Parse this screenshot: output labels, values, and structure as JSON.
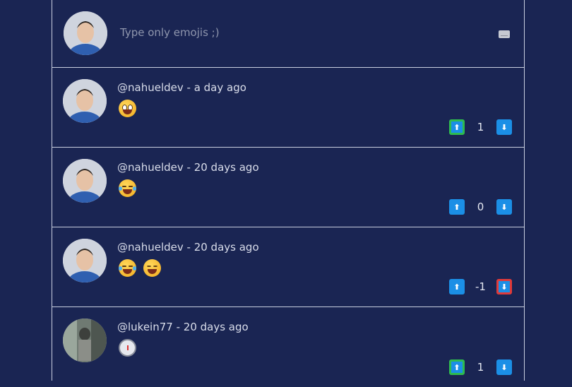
{
  "composer": {
    "placeholder": "Type only emojis ;)",
    "keyboard_icon": "keyboard-icon"
  },
  "posts": [
    {
      "user": "@nahueldev",
      "separator": " - ",
      "time": "a day ago",
      "emojis": [
        "grinning-face-emoji"
      ],
      "votes": "1",
      "vote_state": "up"
    },
    {
      "user": "@nahueldev",
      "separator": " - ",
      "time": "20 days ago",
      "emojis": [
        "tears-of-joy-emoji"
      ],
      "votes": "0",
      "vote_state": "none"
    },
    {
      "user": "@nahueldev",
      "separator": " - ",
      "time": "20 days ago",
      "emojis": [
        "tears-of-joy-emoji",
        "squinting-face-emoji"
      ],
      "votes": "-1",
      "vote_state": "down"
    },
    {
      "user": "@lukein77",
      "separator": " - ",
      "time": "20 days ago",
      "emojis": [
        "stopwatch-emoji"
      ],
      "votes": "1",
      "vote_state": "up"
    }
  ],
  "colors": {
    "background": "#1a2553",
    "upvote_active": "#2ebc4f",
    "downvote_active": "#e03a3a",
    "vote_button": "#1b8fe6"
  }
}
